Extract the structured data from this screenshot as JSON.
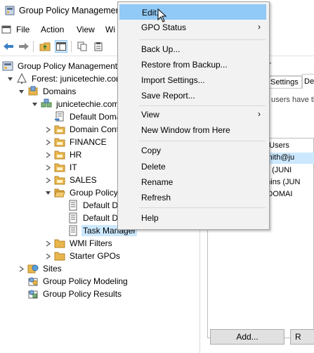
{
  "window": {
    "title": "Group Policy Management"
  },
  "menubar": {
    "items": [
      "File",
      "Action",
      "View",
      "Wi"
    ]
  },
  "tree": {
    "root": "Group Policy Management",
    "forest": "Forest: junicetechie.com",
    "domains": "Domains",
    "domain": "junicetechie.com",
    "default_domain_policy": "Default Domain Policy",
    "domain_controllers": "Domain Controllers",
    "finance": "FINANCE",
    "hr": "HR",
    "it": "IT",
    "sales": "SALES",
    "gpo_folder": "Group Policy Objects",
    "gpo_default1": "Default Domain Controllers Policy",
    "gpo_default2": "Default Domain Policy",
    "task_manager": "Task Manager",
    "wmi_filters": "WMI Filters",
    "starter_gpos": "Starter GPOs",
    "sites": "Sites",
    "modeling": "Group Policy Modeling",
    "results": "Group Policy Results"
  },
  "right_pane": {
    "header_fragment": "r",
    "tab_settings": "Settings",
    "tab_delegation": "De",
    "desc_fragment": "users have th",
    "list_header": "d Users",
    "rows": [
      ".smith@ju",
      "ins (JUNI",
      "dmins (JUN",
      "E DOMAI"
    ],
    "add_button": "Add...",
    "other_button": "R"
  },
  "context_menu": {
    "items": [
      {
        "label": "Edit...",
        "highlighted": true
      },
      {
        "label": "GPO Status",
        "submenu": true
      },
      {
        "label": "Back Up..."
      },
      {
        "label": "Restore from Backup..."
      },
      {
        "label": "Import Settings..."
      },
      {
        "label": "Save Report..."
      },
      {
        "label": "View",
        "submenu": true
      },
      {
        "label": "New Window from Here"
      },
      {
        "label": "Copy"
      },
      {
        "label": "Delete"
      },
      {
        "label": "Rename"
      },
      {
        "label": "Refresh"
      },
      {
        "label": "Help"
      }
    ]
  },
  "colors": {
    "menu_highlight": "#91c9f7",
    "tree_selection": "#cce8ff",
    "folder": "#e8b64c"
  }
}
